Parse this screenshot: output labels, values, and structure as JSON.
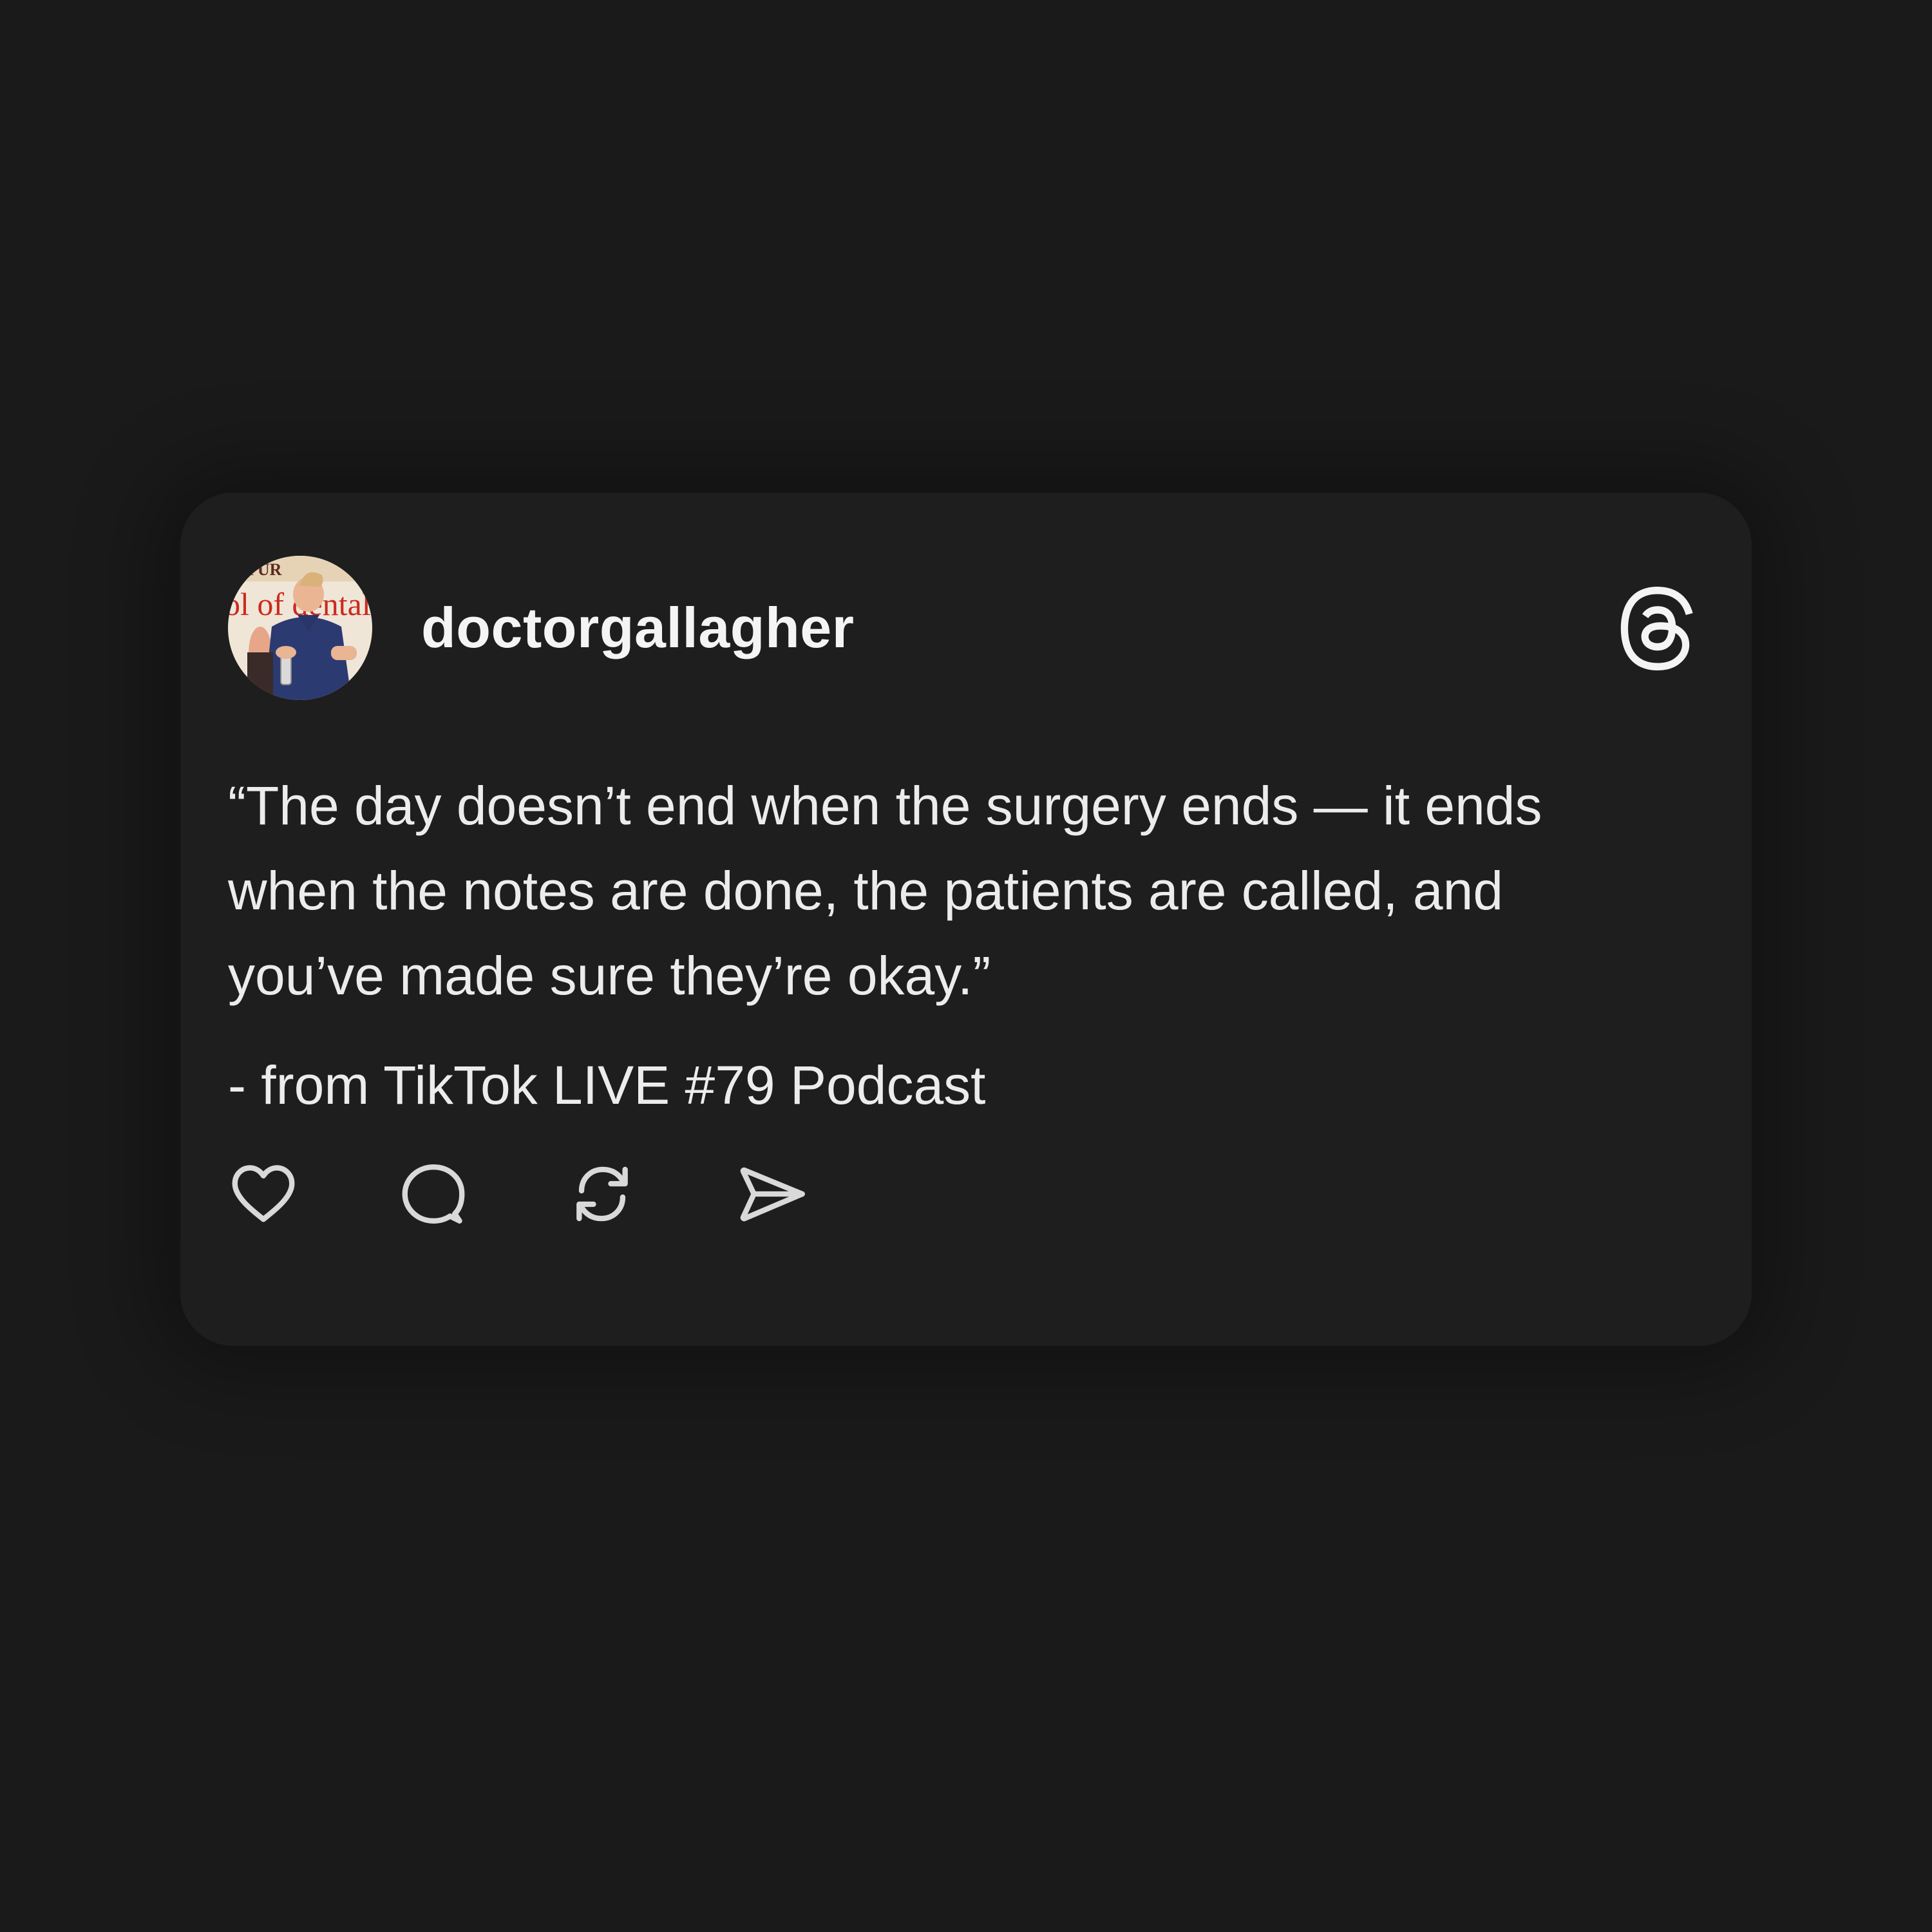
{
  "post": {
    "username": "doctorgallagher",
    "quote": "“The day doesn’t end when the surgery ends — it ends when the notes are done, the patients are called, and you’ve made sure they’re okay.”",
    "source": "- from TikTok LIVE #79 Podcast"
  },
  "avatar": {
    "image_text": "ol of dental"
  },
  "icons": {
    "brand": "threads-logo-icon",
    "like": "heart-icon",
    "comment": "comment-bubble-icon",
    "repost": "repost-icon",
    "share": "send-icon"
  },
  "colors": {
    "background": "#1a1a1a",
    "card": "#1e1e1e",
    "text": "#ececec",
    "icon": "#d9d9d9"
  }
}
